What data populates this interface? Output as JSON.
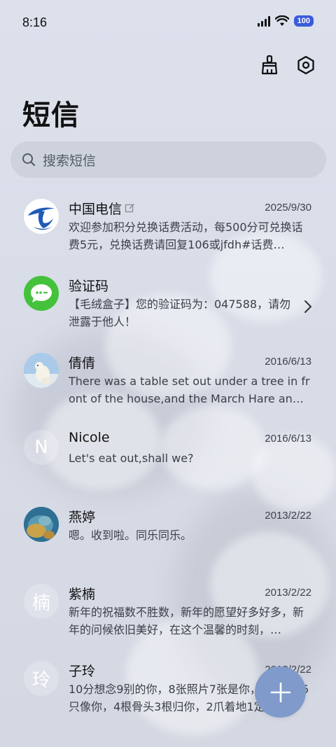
{
  "status_bar": {
    "time": "8:16",
    "battery": "100"
  },
  "header": {
    "title": "短信"
  },
  "search": {
    "placeholder": "搜索短信"
  },
  "conversations": [
    {
      "name": "中国电信",
      "date": "2025/9/30",
      "preview": "欢迎参加积分兑换话费活动，每500分可兑换话费5元，兑换话费请回复106或jfdh#话费…",
      "avatar": "china-telecom-logo-icon",
      "tag": "edit-icon"
    },
    {
      "name": "验证码",
      "date": "",
      "preview": "【毛绒盒子】您的验证码为：047588，请勿泄露于他人！",
      "avatar": "message-code-icon"
    },
    {
      "name": "倩倩",
      "date": "2016/6/13",
      "preview": "There was a table set out under a tree in front of the house,and the March Hare an…",
      "avatar": "polar-bear-photo"
    },
    {
      "name": "Nicole",
      "date": "2016/6/13",
      "preview": "Let's eat out,shall we?",
      "avatar_letter": "N"
    },
    {
      "name": "燕婷",
      "date": "2013/2/22",
      "preview": "嗯。收到啦。同乐同乐。",
      "avatar": "landscape-photo"
    },
    {
      "name": "紫楠",
      "date": "2013/2/22",
      "preview": "新年的祝福数不胜数，新年的愿望好多好多，新年的问候依旧美好，在这个温馨的时刻，…",
      "avatar_letter": "楠"
    },
    {
      "name": "子玲",
      "date": "2013/2/22",
      "preview": "10分想念9别的你，8张照片7张是你，6只小狗5只像你，4根骨头3根归你，2爪着地1定…",
      "avatar_letter": "玲"
    }
  ],
  "colors": {
    "accent": "#7f9acb",
    "telecom_blue": "#1e5bb8",
    "code_green": "#45c23c",
    "battery": "#3b5bdb"
  },
  "icons": {
    "clean": "broom-icon",
    "settings": "hexagon-settings-icon",
    "search": "search-icon",
    "compose": "plus-icon",
    "chevron": "chevron-right-icon"
  }
}
